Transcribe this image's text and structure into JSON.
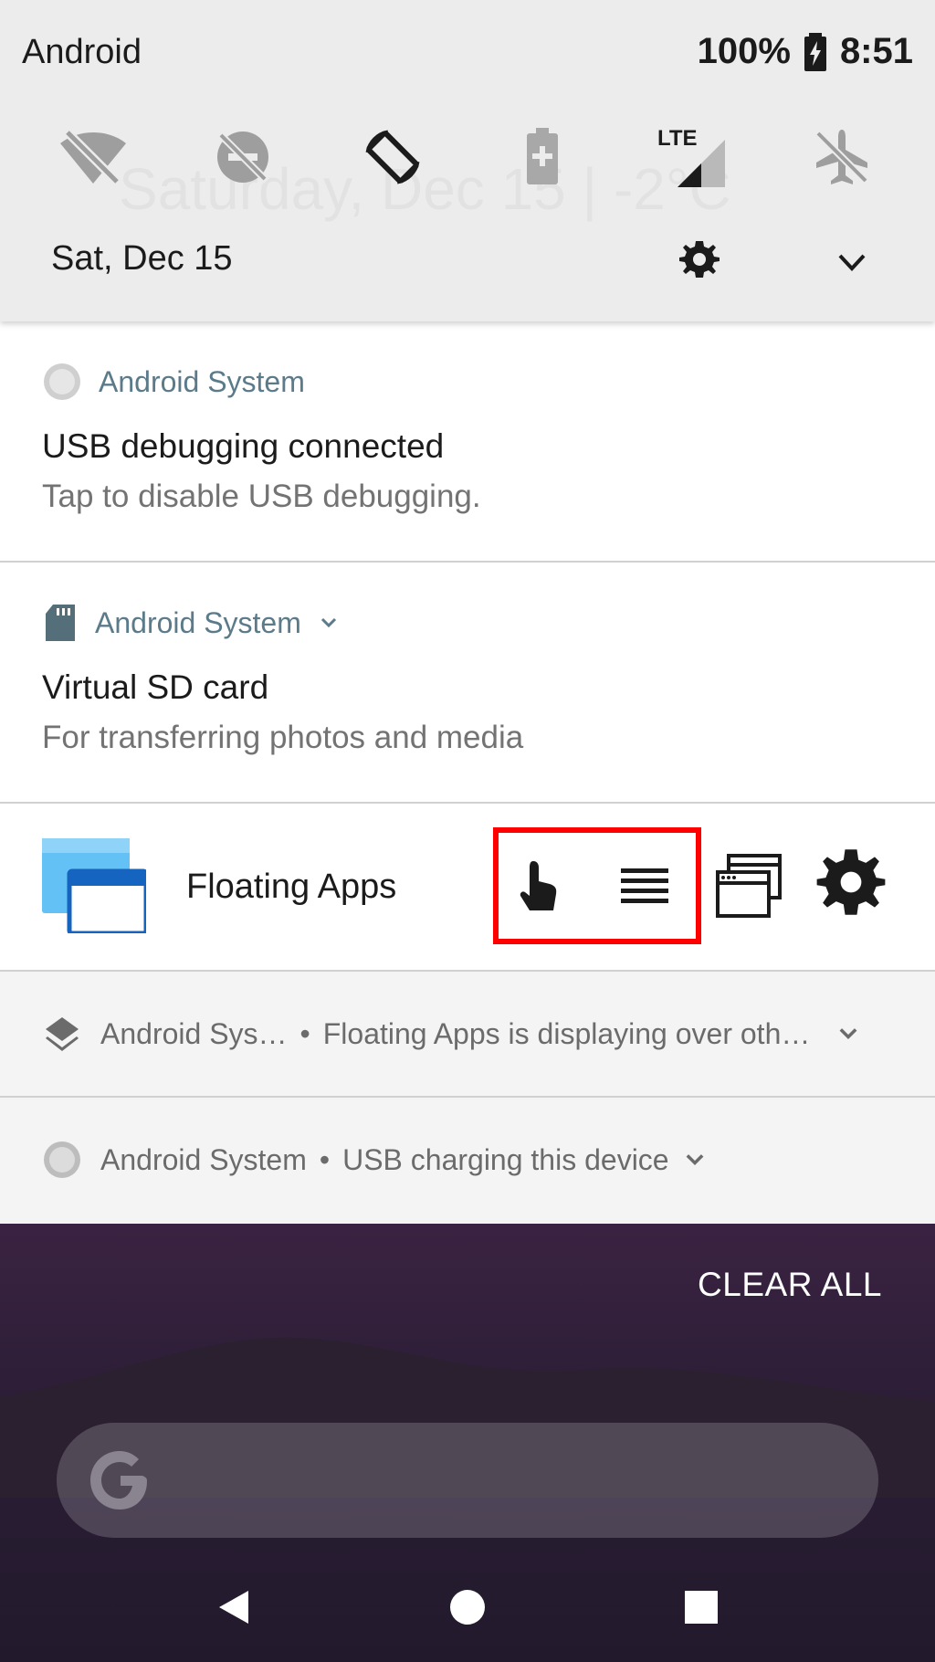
{
  "status_bar": {
    "carrier": "Android",
    "battery": "100%",
    "time": "8:51",
    "icons": [
      "battery-charging-icon"
    ]
  },
  "quick_settings": {
    "tiles": [
      {
        "name": "wifi-off-icon"
      },
      {
        "name": "do-not-disturb-off-icon"
      },
      {
        "name": "auto-rotate-icon"
      },
      {
        "name": "battery-saver-icon"
      },
      {
        "name": "mobile-data-lte-icon",
        "label": "LTE"
      },
      {
        "name": "airplane-mode-icon"
      }
    ],
    "date": "Sat, Dec 15",
    "ghost_clock": "Saturday, Dec 15  |  -2°C",
    "settings_icon": "gear-icon",
    "expand_icon": "chevron-down-icon"
  },
  "notifications": [
    {
      "app": "Android System",
      "title": "USB debugging connected",
      "text": "Tap to disable USB debugging."
    },
    {
      "app": "Android System",
      "title": "Virtual SD card",
      "text": "For transferring photos and media"
    },
    {
      "app": "Floating Apps",
      "actions": [
        "touch-icon",
        "menu-lines-icon",
        "windows-icon",
        "gear-icon"
      ]
    },
    {
      "app": "Android Sys…",
      "text": "Floating Apps is displaying over oth…"
    },
    {
      "app": "Android System",
      "text": "USB charging this device"
    }
  ],
  "bullet": "•",
  "clear_all": "CLEAR ALL",
  "accent": "#ff0000",
  "app_label_color": "#5b7a8a"
}
